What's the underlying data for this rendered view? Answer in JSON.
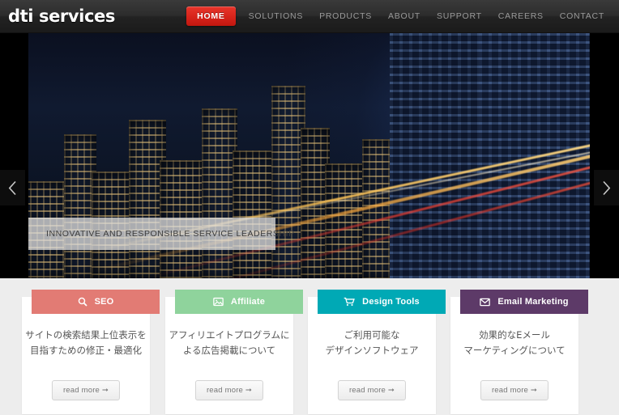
{
  "header": {
    "logo": "dti services",
    "nav": [
      {
        "label": "HOME",
        "active": true
      },
      {
        "label": "SOLUTIONS",
        "active": false
      },
      {
        "label": "PRODUCTS",
        "active": false
      },
      {
        "label": "ABOUT",
        "active": false
      },
      {
        "label": "SUPPORT",
        "active": false
      },
      {
        "label": "CAREERS",
        "active": false
      },
      {
        "label": "CONTACT",
        "active": false
      }
    ],
    "accent_color": "#d8251c"
  },
  "hero": {
    "caption": "INNOVATIVE AND RESPONSIBLE SERVICE LEADERSHIP",
    "prev_icon": "chevron-left-icon",
    "next_icon": "chevron-right-icon",
    "background_color": "#000000"
  },
  "cards": [
    {
      "title": "SEO",
      "icon": "search-icon",
      "color": "#e27b74",
      "desc_line1": "サイトの検索結果上位表示を",
      "desc_line2": "目指すための修正・最適化",
      "button": "read more ➞"
    },
    {
      "title": "Affiliate",
      "icon": "image-icon",
      "color": "#8fd39c",
      "desc_line1": "アフィリエイトプログラムに",
      "desc_line2": "よる広告掲載について",
      "button": "read more ➞"
    },
    {
      "title": "Design Tools",
      "icon": "shopping-cart-icon",
      "color": "#00a9b5",
      "desc_line1": "ご利用可能な",
      "desc_line2": "デザインソフトウェア",
      "button": "read more ➞"
    },
    {
      "title": "Email Marketing",
      "icon": "envelope-icon",
      "color": "#5d3a68",
      "desc_line1": "効果的なEメール",
      "desc_line2": "マーケティングについて",
      "button": "read more ➞"
    }
  ]
}
